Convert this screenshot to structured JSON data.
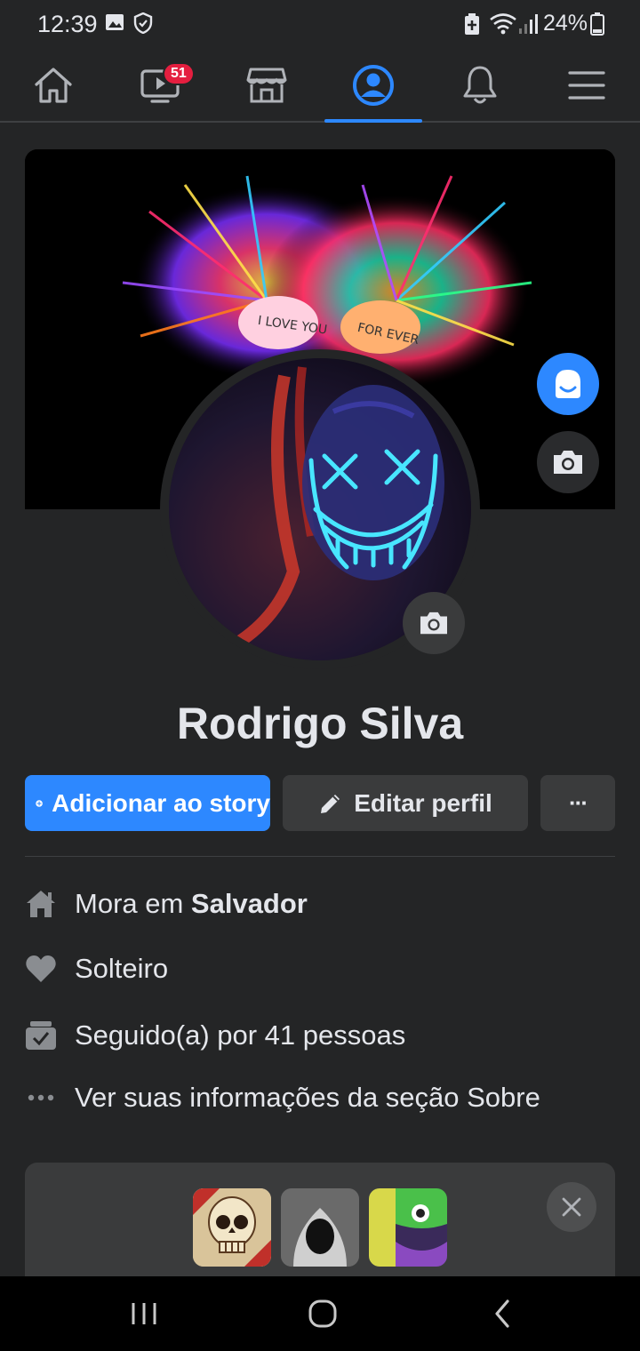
{
  "status_bar": {
    "time": "12:39",
    "battery": "24%",
    "icons": [
      "gallery-icon",
      "shield-icon",
      "battery-saver-icon",
      "wifi-icon",
      "signal-icon",
      "battery-icon"
    ]
  },
  "nav": {
    "tabs": [
      {
        "name": "home",
        "icon": "home-icon"
      },
      {
        "name": "watch",
        "icon": "video-icon",
        "badge": "51"
      },
      {
        "name": "marketplace",
        "icon": "store-icon"
      },
      {
        "name": "profile",
        "icon": "profile-icon",
        "active": true
      },
      {
        "name": "notifications",
        "icon": "bell-icon"
      },
      {
        "name": "menu",
        "icon": "hamburger-icon"
      }
    ]
  },
  "cover_art_text": [
    "I LOVE YOU",
    "FOR EVER"
  ],
  "profile": {
    "name": "Rodrigo Silva"
  },
  "actions": {
    "add_story": "Adicionar ao story",
    "edit_profile": "Editar perfil",
    "more": "···"
  },
  "info": {
    "lives_in_prefix": "Mora em ",
    "lives_in_city": "Salvador",
    "relationship": "Solteiro",
    "followers": "Seguido(a) por 41 pessoas",
    "see_about": "Ver suas informações da seção Sobre"
  },
  "colors": {
    "background": "#242526",
    "primary": "#2d88ff",
    "badge": "#e41e3f",
    "surface": "#3a3b3c"
  }
}
